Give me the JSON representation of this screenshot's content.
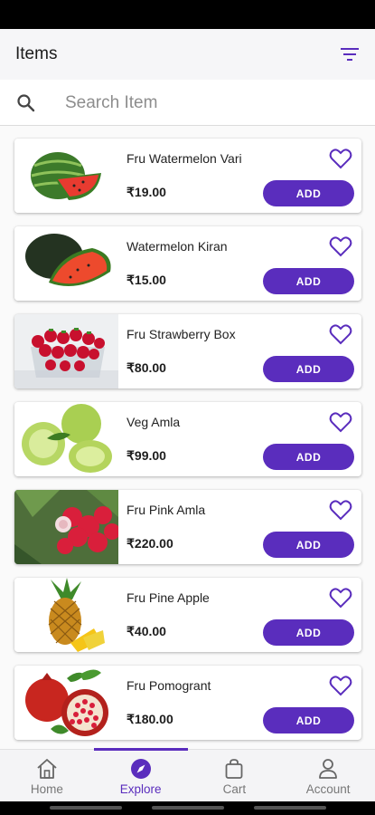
{
  "header": {
    "title": "Items"
  },
  "search": {
    "placeholder": "Search Item"
  },
  "items": [
    {
      "name": "Fru Watermelon Vari",
      "price": "₹19.00",
      "add_label": "ADD",
      "image": "watermelon-striped"
    },
    {
      "name": "Watermelon Kiran",
      "price": "₹15.00",
      "add_label": "ADD",
      "image": "watermelon-dark"
    },
    {
      "name": "Fru Strawberry Box",
      "price": "₹80.00",
      "add_label": "ADD",
      "image": "strawberry-box"
    },
    {
      "name": "Veg Amla",
      "price": "₹99.00",
      "add_label": "ADD",
      "image": "amla"
    },
    {
      "name": "Fru Pink Amla",
      "price": "₹220.00",
      "add_label": "ADD",
      "image": "pink-amla"
    },
    {
      "name": "Fru Pine Apple",
      "price": "₹40.00",
      "add_label": "ADD",
      "image": "pineapple"
    },
    {
      "name": "Fru Pomogrant",
      "price": "₹180.00",
      "add_label": "ADD",
      "image": "pomegranate"
    }
  ],
  "nav": [
    {
      "label": "Home",
      "icon": "home-icon",
      "active": false
    },
    {
      "label": "Explore",
      "icon": "compass-icon",
      "active": true
    },
    {
      "label": "Cart",
      "icon": "bag-icon",
      "active": false
    },
    {
      "label": "Account",
      "icon": "person-icon",
      "active": false
    }
  ],
  "colors": {
    "accent": "#5a2dbd",
    "app_bar": "#f6f6f8"
  }
}
